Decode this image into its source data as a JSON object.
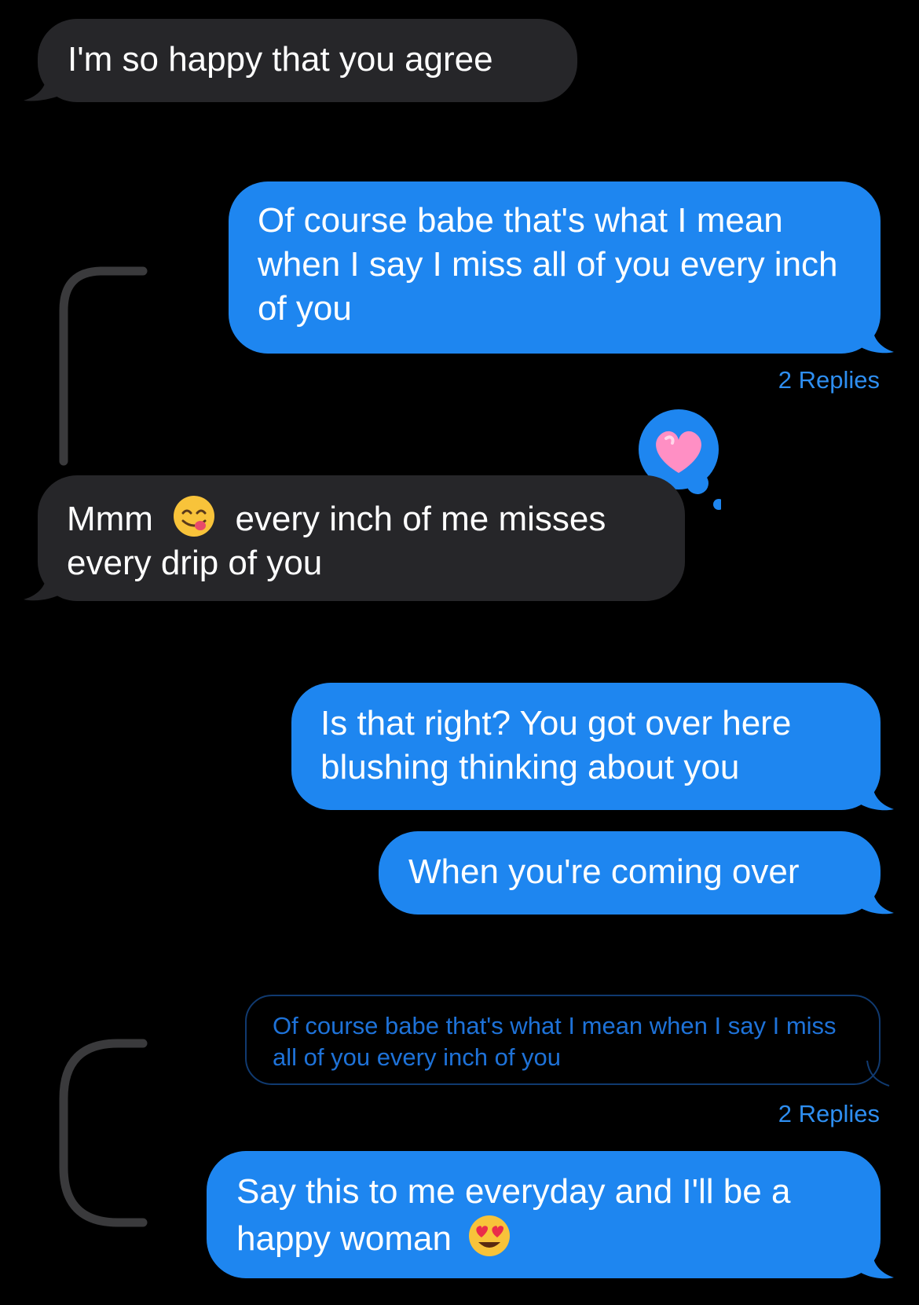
{
  "messages": [
    {
      "id": "m1",
      "sender": "them",
      "text": "I'm so happy that you agree"
    },
    {
      "id": "m2",
      "sender": "me",
      "text": "Of course babe that's what I mean when I say I miss all of you every inch of you",
      "replies": "2 Replies"
    },
    {
      "id": "m3",
      "sender": "them",
      "text_before": "Mmm",
      "emoji": "face-savoring-food",
      "text_after": "every inch of me misses every drip of you",
      "tapback": "heart"
    },
    {
      "id": "m4",
      "sender": "me",
      "text": "Is that right? You got over here blushing thinking about you"
    },
    {
      "id": "m5",
      "sender": "me",
      "text": "When you're coming over"
    },
    {
      "id": "m6",
      "sender": "me",
      "quoted": "Of course babe that's what I mean when I say I miss all of you every inch of you",
      "replies": "2 Replies",
      "text": "Say this to me everyday and I'll be a happy woman",
      "emoji": "smiling-face-with-heart-eyes"
    }
  ],
  "colors": {
    "background": "#000000",
    "incoming": "#262629",
    "outgoing": "#1e86f0",
    "link": "#2e8ef0",
    "thread": "#3a3a3c"
  }
}
